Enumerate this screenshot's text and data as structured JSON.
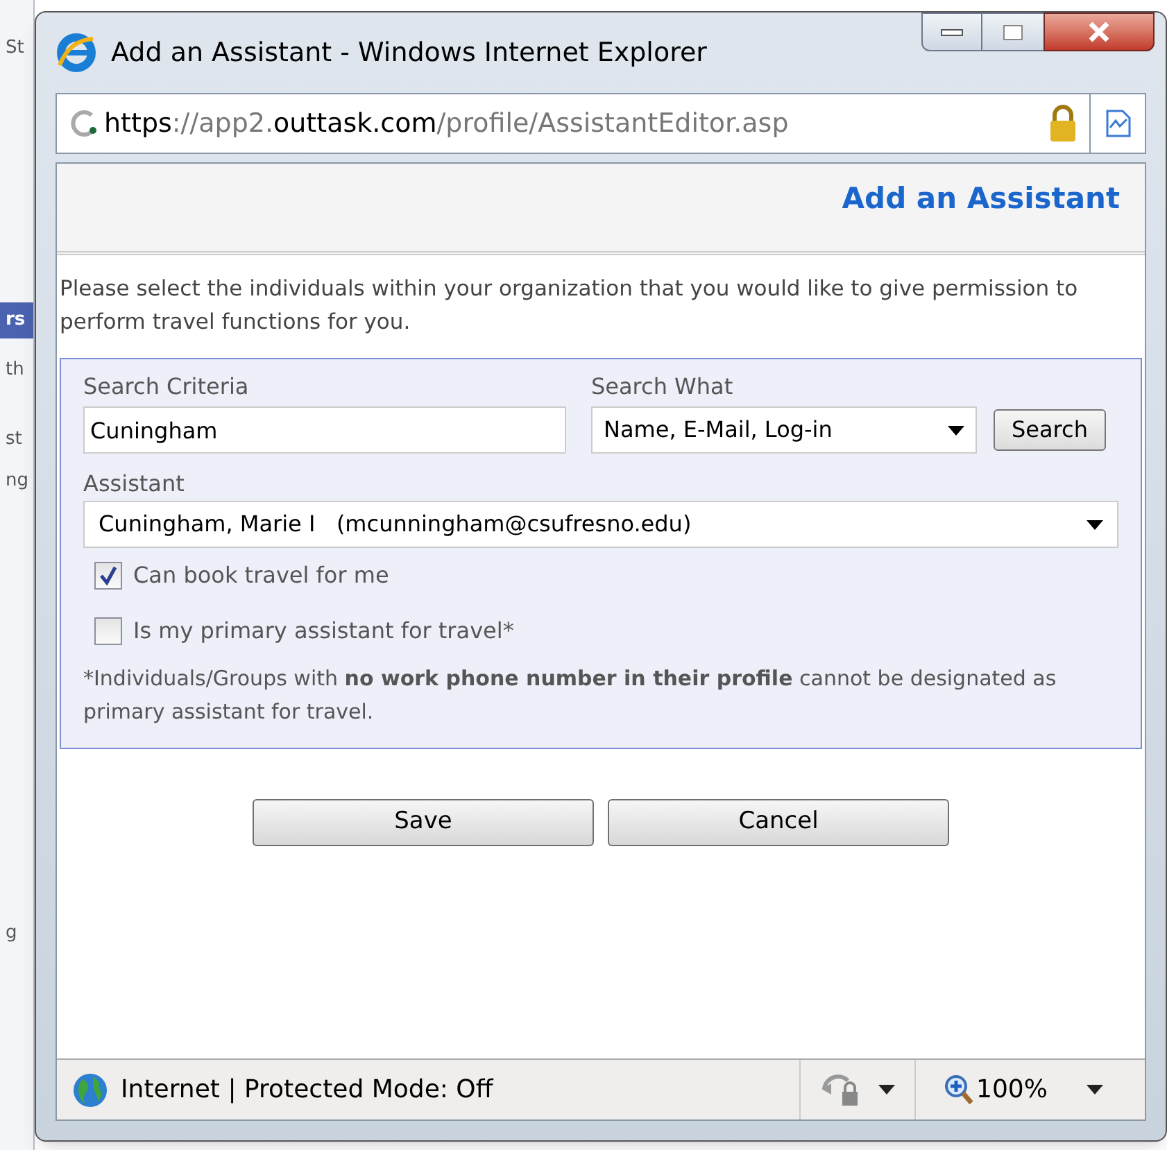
{
  "background_page": {
    "fragments": [
      {
        "text": "St",
        "highlighted": false
      },
      {
        "text": "rs",
        "highlighted": true
      },
      {
        "text": "th",
        "highlighted": false
      },
      {
        "text": "st",
        "highlighted": false
      },
      {
        "text": "ng",
        "highlighted": false
      },
      {
        "text": "g",
        "highlighted": false
      }
    ]
  },
  "window": {
    "title": "Add an Assistant - Windows Internet Explorer"
  },
  "address_bar": {
    "url_parts": [
      {
        "text": "https",
        "dim": false
      },
      {
        "text": "://app2.",
        "dim": true
      },
      {
        "text": "outtask.com",
        "dim": false
      },
      {
        "text": "/profile/AssistantEditor.asp",
        "dim": true
      }
    ]
  },
  "page": {
    "heading": "Add an Assistant",
    "intro": "Please select the individuals within your organization that you would like to give permission to perform travel functions for you.",
    "search_criteria": {
      "label": "Search Criteria",
      "value": "Cuningham"
    },
    "search_what": {
      "label": "Search What",
      "value": "Name, E-Mail, Log-in"
    },
    "search_button": "Search",
    "assistant": {
      "label": "Assistant",
      "value": "Cuningham, Marie I   (mcunningham@csufresno.edu)"
    },
    "options": [
      {
        "label": "Can book travel for me",
        "checked": true
      },
      {
        "label": "Is my primary assistant for travel*",
        "checked": false
      }
    ],
    "note": "*Individuals/Groups with **no work phone number in their profile** cannot be designated as primary assistant for travel.",
    "buttons": [
      "Save",
      "Cancel"
    ]
  },
  "status_bar": {
    "zone": "Internet | Protected Mode: Off",
    "zoom": "100%"
  }
}
